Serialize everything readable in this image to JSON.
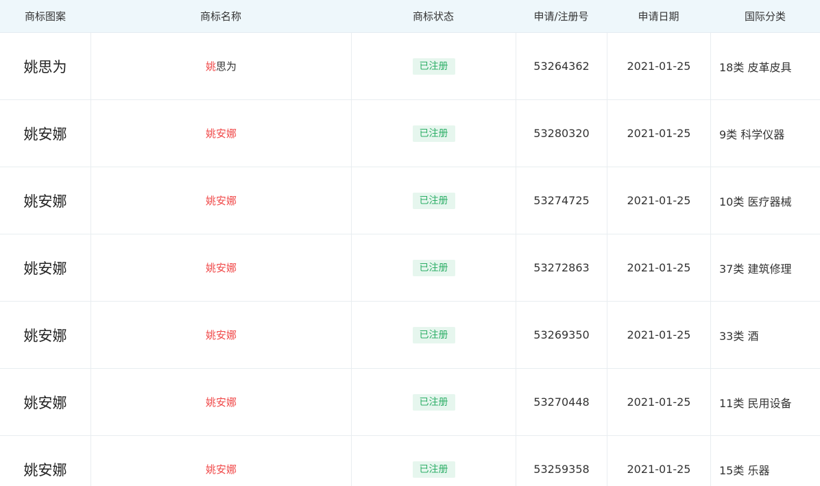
{
  "header": {
    "logo": "商标图案",
    "name": "商标名称",
    "status": "商标状态",
    "reg_no": "申请/注册号",
    "date": "申请日期",
    "class": "国际分类"
  },
  "colors": {
    "header_bg": "#eef7fb",
    "highlight": "#f04848",
    "badge_bg": "#e6f6ee",
    "badge_text": "#2cae66"
  },
  "rows": [
    {
      "logo": "姚思为",
      "name_hl": "姚",
      "name_rest": "思为",
      "status": "已注册",
      "reg_no": "53264362",
      "date": "2021-01-25",
      "class": "18类 皮革皮具"
    },
    {
      "logo": "姚安娜",
      "name_hl": "姚安娜",
      "name_rest": "",
      "status": "已注册",
      "reg_no": "53280320",
      "date": "2021-01-25",
      "class": "9类 科学仪器"
    },
    {
      "logo": "姚安娜",
      "name_hl": "姚安娜",
      "name_rest": "",
      "status": "已注册",
      "reg_no": "53274725",
      "date": "2021-01-25",
      "class": "10类 医疗器械"
    },
    {
      "logo": "姚安娜",
      "name_hl": "姚安娜",
      "name_rest": "",
      "status": "已注册",
      "reg_no": "53272863",
      "date": "2021-01-25",
      "class": "37类 建筑修理"
    },
    {
      "logo": "姚安娜",
      "name_hl": "姚安娜",
      "name_rest": "",
      "status": "已注册",
      "reg_no": "53269350",
      "date": "2021-01-25",
      "class": "33类 酒"
    },
    {
      "logo": "姚安娜",
      "name_hl": "姚安娜",
      "name_rest": "",
      "status": "已注册",
      "reg_no": "53270448",
      "date": "2021-01-25",
      "class": "11类 民用设备"
    },
    {
      "logo": "姚安娜",
      "name_hl": "姚安娜",
      "name_rest": "",
      "status": "已注册",
      "reg_no": "53259358",
      "date": "2021-01-25",
      "class": "15类 乐器"
    }
  ]
}
